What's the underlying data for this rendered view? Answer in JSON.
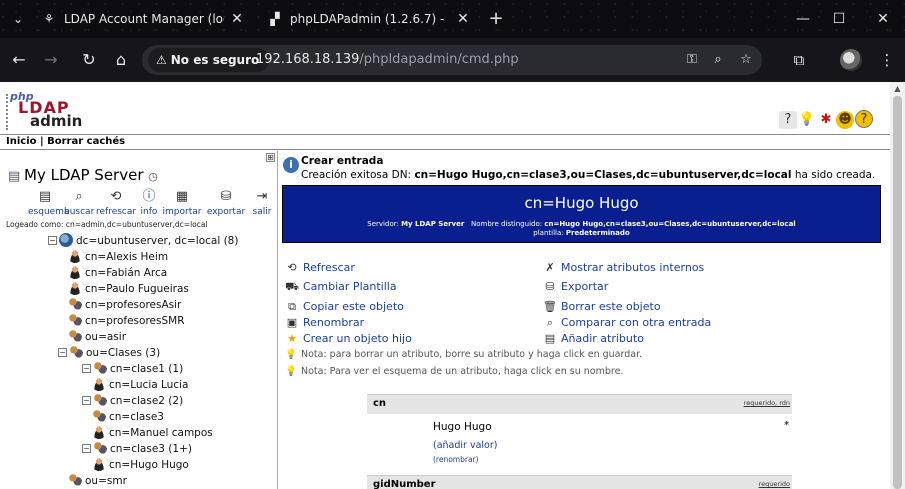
{
  "browser": {
    "tabs": [
      {
        "title": "LDAP Account Manager (localh",
        "icon": "lam-icon"
      },
      {
        "title": "phpLDAPadmin (1.2.6.7) -",
        "icon": "pla-icon"
      }
    ],
    "security_label": "No es seguro",
    "url_host": "192.168.18.139",
    "url_path": "/phpldapadmin/cmd.php"
  },
  "page": {
    "top_links": {
      "home": "Inicio",
      "separator": " | ",
      "clear_cache": "Borrar cachés"
    },
    "server": {
      "name": "My LDAP Server",
      "tools": [
        {
          "label": "esquema",
          "icon": "schema-icon"
        },
        {
          "label": "buscar",
          "icon": "search-icon"
        },
        {
          "label": "refrescar",
          "icon": "refresh-icon"
        },
        {
          "label": "info",
          "icon": "info-icon"
        },
        {
          "label": "importar",
          "icon": "import-icon"
        },
        {
          "label": "exportar",
          "icon": "export-icon"
        },
        {
          "label": "salir",
          "icon": "logout-icon"
        }
      ],
      "logged_as": "Logeado como: cn=admin,dc=ubuntuserver,dc=local"
    },
    "tree": {
      "root": "dc=ubuntuserver, dc=local (8)",
      "items": [
        "cn=Alexis Heim",
        "cn=Fabián Arca",
        "cn=Paulo Fugueiras",
        "cn=profesoresAsir",
        "cn=profesoresSMR",
        "ou=asir",
        "ou=Clases (3)",
        "cn=clase1 (1)",
        "cn=Lucia Lucia",
        "cn=clase2 (2)",
        "cn=clase3",
        "cn=Manuel campos",
        "cn=clase3 (1+)",
        "cn=Hugo Hugo",
        "ou=smr"
      ]
    },
    "notice": {
      "title": "Crear entrada",
      "msg_prefix": "Creación exitosa DN: ",
      "msg_dn": "cn=Hugo Hugo,cn=clase3,ou=Clases,dc=ubuntuserver,dc=local",
      "msg_suffix": " ha sido creada."
    },
    "entry": {
      "title": "cn=Hugo Hugo",
      "server_label": "Servidor: ",
      "server_value": "My LDAP Server",
      "dn_label": "Nombre distinguido: ",
      "dn_value": "cn=Hugo Hugo,cn=clase3,ou=Clases,dc=ubuntuserver,dc=local",
      "template_label": "plantilla: ",
      "template_value": "Predeterminado"
    },
    "actions_left": [
      "Refrescar",
      "Cambiar Plantilla",
      "Copiar este objeto",
      "Renombrar",
      "Crear un objeto hijo"
    ],
    "actions_right": [
      "Mostrar atributos internos",
      "Exportar",
      "Borrar este objeto",
      "Comparar con otra entrada",
      "Añadir atributo"
    ],
    "notes": [
      "Nota: para borrar un atributo, borre su atributo y haga click en guardar.",
      "Nota: Para ver el esquema de un atributo, haga click en su nombre."
    ],
    "attributes": [
      {
        "name": "cn",
        "required": "requerido, rdn",
        "value": "Hugo Hugo",
        "add_value": "(añadir valor)",
        "rename": "(renombrar)"
      },
      {
        "name": "gidNumber",
        "required": "requerido"
      }
    ],
    "required_marker": "*"
  }
}
